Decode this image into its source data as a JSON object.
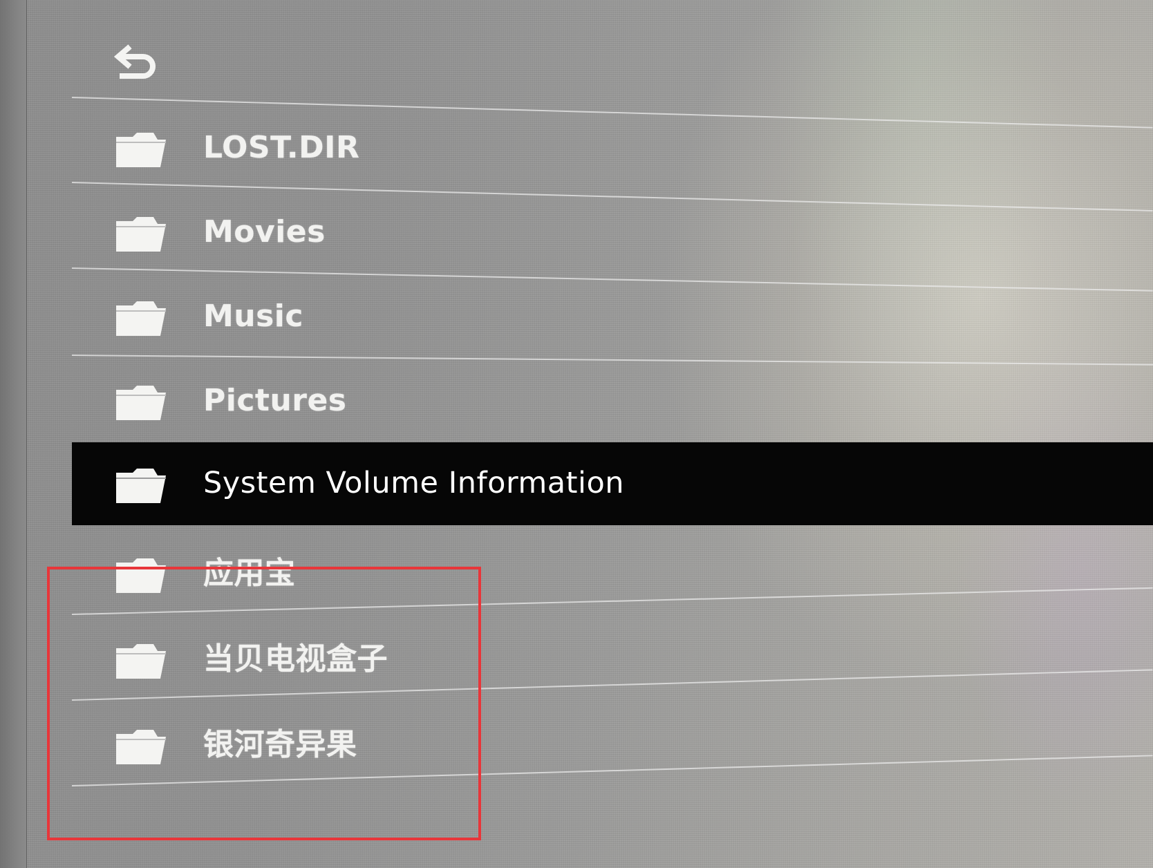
{
  "navigation": {
    "back_icon": "back-arrow-icon"
  },
  "files": [
    {
      "name": "LOST.DIR",
      "icon": "folder-icon",
      "selected": false
    },
    {
      "name": "Movies",
      "icon": "folder-icon",
      "selected": false
    },
    {
      "name": "Music",
      "icon": "folder-icon",
      "selected": false
    },
    {
      "name": "Pictures",
      "icon": "folder-icon",
      "selected": false
    },
    {
      "name": "System Volume Information",
      "icon": "folder-icon",
      "selected": true
    },
    {
      "name": "应用宝",
      "icon": "folder-icon",
      "selected": false
    },
    {
      "name": "当贝电视盒子",
      "icon": "folder-icon",
      "selected": false
    },
    {
      "name": "银河奇异果",
      "icon": "folder-icon",
      "selected": false
    }
  ],
  "colors": {
    "selected_row_background": "#060606",
    "text": "#f2f2f0",
    "annotation_border": "#e8363a"
  }
}
